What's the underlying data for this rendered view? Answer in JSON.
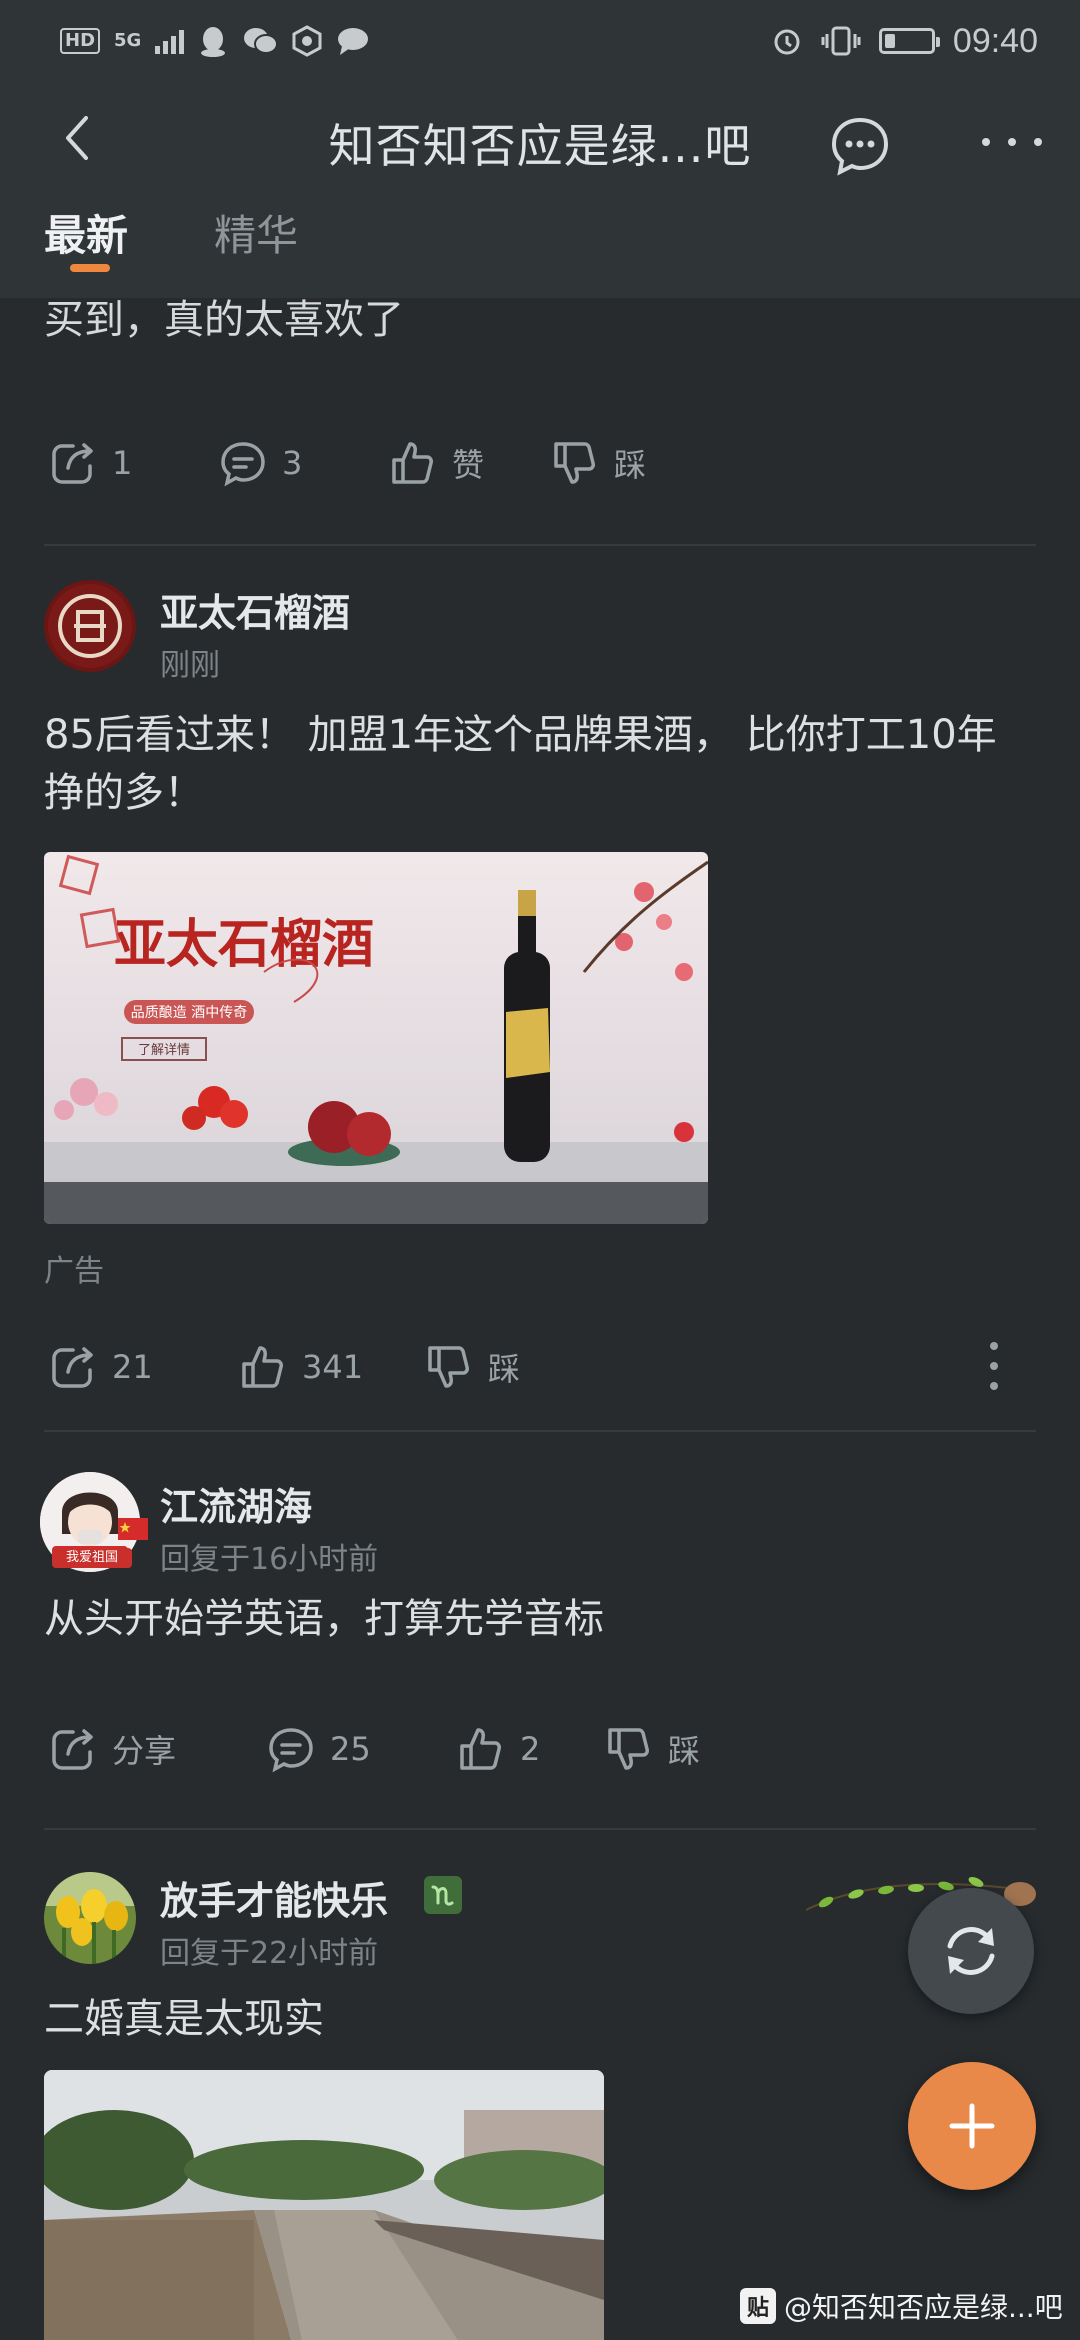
{
  "status_bar": {
    "network_badge": "HD",
    "network_type": "5G",
    "time": "09:40",
    "battery_level_percent": 15
  },
  "header": {
    "title": "知否知否应是绿...吧",
    "tabs": [
      {
        "label": "最新",
        "active": true
      },
      {
        "label": "精华",
        "active": false
      }
    ]
  },
  "colors": {
    "background": "#272b2e",
    "header": "#2f3436",
    "accent": "#f0873e",
    "fab_add": "#e8894a"
  },
  "posts": [
    {
      "partial_text": "买到，真的太喜欢了",
      "actions": {
        "share": "1",
        "comment": "3",
        "like": "赞",
        "dislike": "踩"
      }
    },
    {
      "username": "亚太石榴酒",
      "meta": "刚刚",
      "text": "85后看过来！ 加盟1年这个品牌果酒， 比你打工10年挣的多！",
      "image": {
        "brand": "亚太石榴酒",
        "tagline": "品质酿造  酒中传奇",
        "button": "了解详情"
      },
      "ad_label": "广告",
      "actions": {
        "share": "21",
        "like": "341",
        "dislike": "踩"
      }
    },
    {
      "username": "江流湖海",
      "avatar_badge": "我爱祖国",
      "meta": "回复于16小时前",
      "text": "从头开始学英语，打算先学音标",
      "actions": {
        "share": "分享",
        "comment": "25",
        "like": "2",
        "dislike": "踩"
      }
    },
    {
      "username": "放手才能快乐",
      "meta": "回复于22小时前",
      "text": "二婚真是太现实"
    }
  ],
  "watermark": {
    "logo": "贴",
    "text": "@知否知否应是绿...吧"
  }
}
